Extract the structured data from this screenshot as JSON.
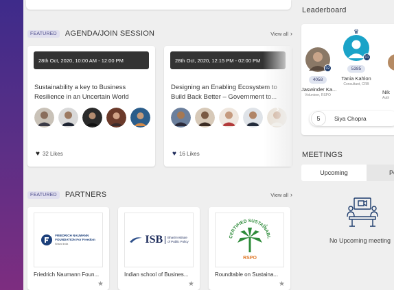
{
  "agenda": {
    "badge": "FEATURED",
    "title": "AGENDA/JOIN SESSION",
    "view_all": "View all"
  },
  "sessions": [
    {
      "date": "28th Oct, 2020, 10:00 AM - 12:00 PM",
      "title": "Sustainability a key to Business Resilience in an Uncertain World",
      "likes": "32 Likes"
    },
    {
      "date": "28th Oct, 2020, 12:15 PM - 02:00 PM",
      "title": "Designing an Enabling Ecosystem to Build Back Better – Government to...",
      "likes": "16 Likes"
    }
  ],
  "partners_section": {
    "badge": "FEATURED",
    "title": "PARTNERS",
    "view_all": "View all"
  },
  "partners": [
    {
      "name": "Friedrich Naumann Foun...",
      "logo_line1": "FRIEDRICH NAUMANN",
      "logo_line2": "FOUNDATION For Freedom",
      "logo_line3": "Bharat India"
    },
    {
      "name": "Indian school of Busines...",
      "logo_main": "ISB",
      "logo_sub1": "Bharti Institute",
      "logo_sub2": "of Public Policy"
    },
    {
      "name": "Roundtable on Sustaina...",
      "logo_arc": "CERTIFIED SUSTAINABLE PALM OIL",
      "logo_tm": "TM",
      "logo_rspo": "RSPO"
    }
  ],
  "leaderboard": {
    "title": "Leaderboard",
    "people": [
      {
        "name": "Jaswinder Ka...",
        "role": "Volunteer, RSPO",
        "points": "4058",
        "rank": "02"
      },
      {
        "name": "Tania Kahlon",
        "role": "Consultant, CRB",
        "points": "5385",
        "rank": "01"
      },
      {
        "name": "Nik",
        "role": "Auth",
        "points": "",
        "rank": ""
      }
    ],
    "my_rank": "5",
    "my_name": "Siya Chopra"
  },
  "meetings": {
    "title": "MEETINGS",
    "tabs": [
      "Upcoming",
      "Pe"
    ],
    "empty_text": "No Upcoming meeting"
  },
  "colors": {
    "sidebar_top": "#3e2b8a",
    "sidebar_bottom": "#7d2d80",
    "page_bg": "#efefef",
    "date_bar": "#333333",
    "points_pill": "#dfe4f0",
    "rank_badge": "#1b3a6b",
    "teal_avatar": "#1aa3c8"
  }
}
